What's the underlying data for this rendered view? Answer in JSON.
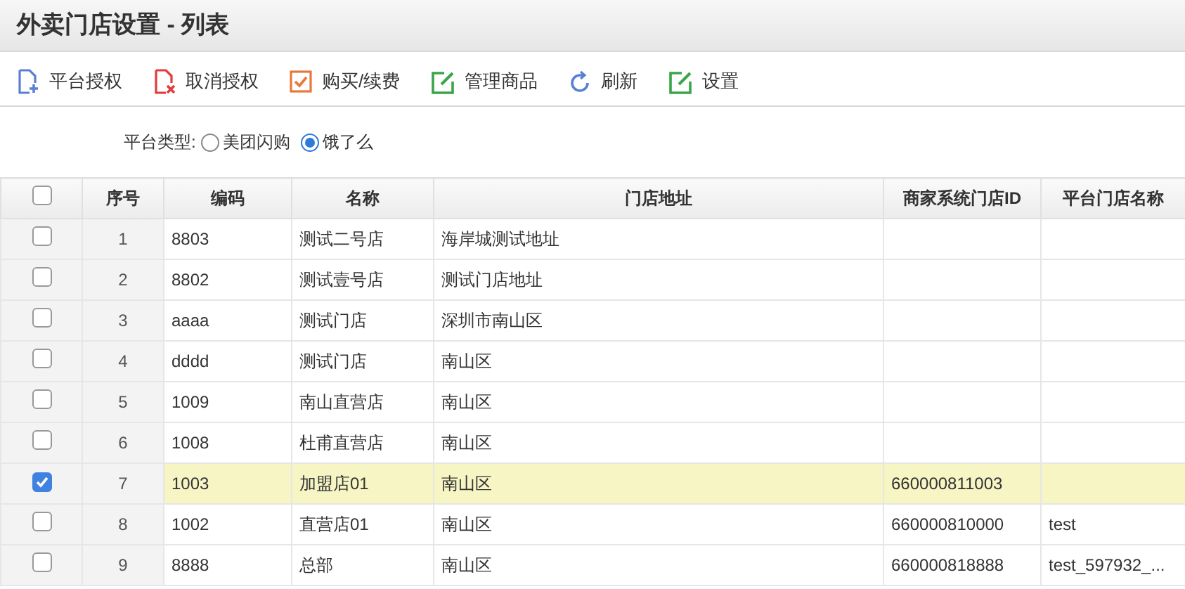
{
  "window": {
    "title": "外卖门店设置 - 列表"
  },
  "toolbar": [
    {
      "label": "平台授权",
      "kind": "add-doc"
    },
    {
      "label": "取消授权",
      "kind": "remove-doc"
    },
    {
      "label": "购买/续费",
      "kind": "check"
    },
    {
      "label": "管理商品",
      "kind": "edit"
    },
    {
      "label": "刷新",
      "kind": "refresh"
    },
    {
      "label": "设置",
      "kind": "edit"
    }
  ],
  "filter": {
    "label": "平台类型:",
    "options": [
      {
        "label": "美团闪购",
        "selected": false
      },
      {
        "label": "饿了么",
        "selected": true
      }
    ]
  },
  "table": {
    "all_checked": false,
    "columns": [
      "序号",
      "编码",
      "名称",
      "门店地址",
      "商家系统门店ID",
      "平台门店名称"
    ],
    "rows": [
      {
        "checked": false,
        "cells": [
          "1",
          "8803",
          "测试二号店",
          "海岸城测试地址",
          "",
          ""
        ]
      },
      {
        "checked": false,
        "cells": [
          "2",
          "8802",
          "测试壹号店",
          "测试门店地址",
          "",
          ""
        ]
      },
      {
        "checked": false,
        "cells": [
          "3",
          "aaaa",
          "测试门店",
          "深圳市南山区",
          "",
          ""
        ]
      },
      {
        "checked": false,
        "cells": [
          "4",
          "dddd",
          "测试门店",
          "南山区",
          "",
          ""
        ]
      },
      {
        "checked": false,
        "cells": [
          "5",
          "1009",
          "南山直营店",
          "南山区",
          "",
          ""
        ]
      },
      {
        "checked": false,
        "cells": [
          "6",
          "1008",
          "杜甫直营店",
          "南山区",
          "",
          ""
        ]
      },
      {
        "checked": true,
        "cells": [
          "7",
          "1003",
          "加盟店01",
          "南山区",
          "660000811003",
          ""
        ]
      },
      {
        "checked": false,
        "cells": [
          "8",
          "1002",
          "直营店01",
          "南山区",
          "660000810000",
          "test"
        ]
      },
      {
        "checked": false,
        "cells": [
          "9",
          "8888",
          "总部",
          "南山区",
          "660000818888",
          "test_597932_..."
        ]
      }
    ]
  }
}
